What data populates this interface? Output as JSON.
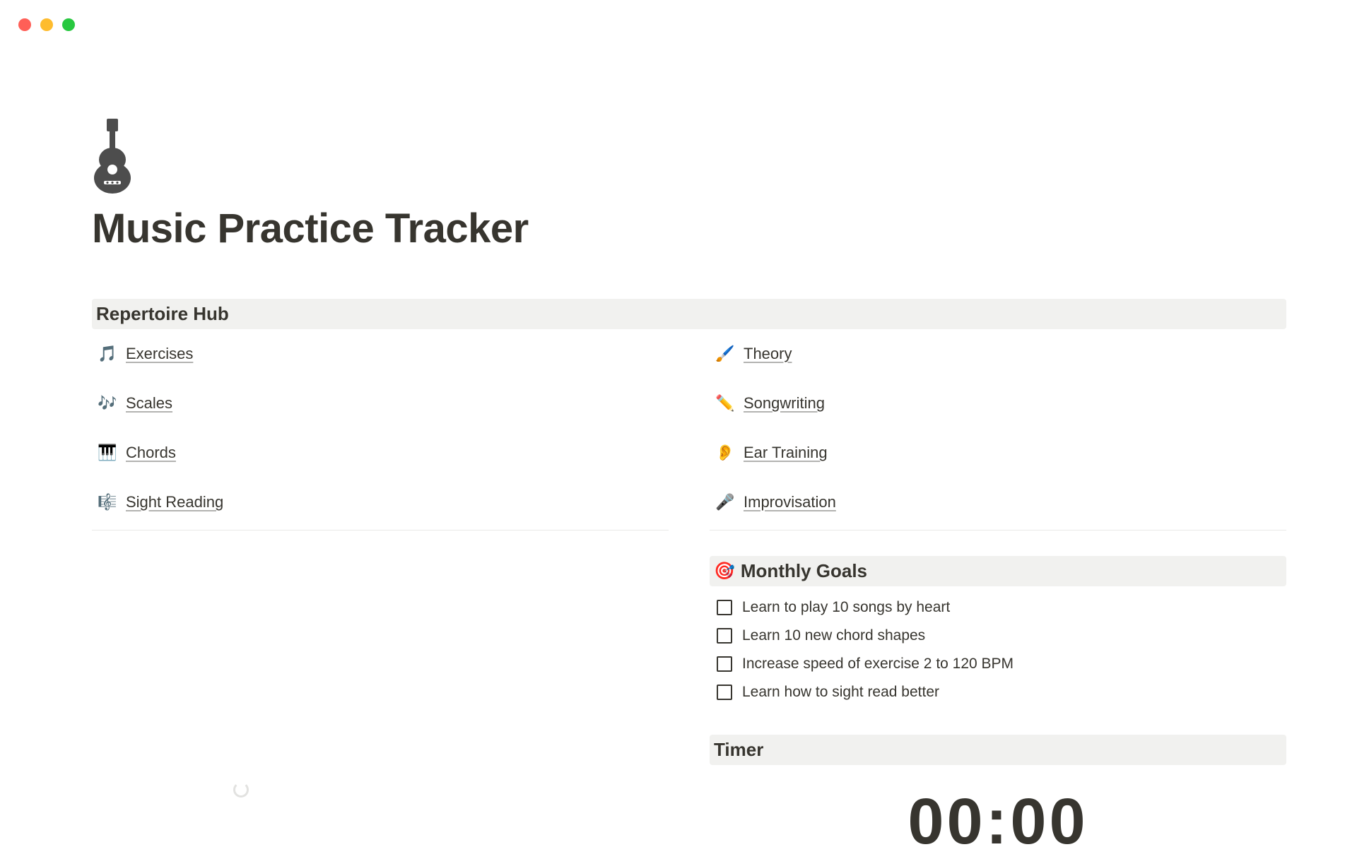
{
  "page": {
    "title": "Music Practice Tracker"
  },
  "sections": {
    "repertoire_header": "Repertoire Hub",
    "goals_header": "Monthly Goals",
    "timer_header": "Timer"
  },
  "repertoire": {
    "left": [
      {
        "icon": "🎵",
        "icon_name": "music-note-icon",
        "label": "Exercises"
      },
      {
        "icon": "🎶",
        "icon_name": "music-notes-icon",
        "label": "Scales"
      },
      {
        "icon": "🎹",
        "icon_name": "piano-icon",
        "label": "Chords"
      },
      {
        "icon": "🎼",
        "icon_name": "musical-score-icon",
        "label": "Sight Reading"
      }
    ],
    "right": [
      {
        "icon": "🖌️",
        "icon_name": "brush-icon",
        "label": "Theory"
      },
      {
        "icon": "✏️",
        "icon_name": "pencil-icon",
        "label": "Songwriting"
      },
      {
        "icon": "👂",
        "icon_name": "ear-icon",
        "label": "Ear Training"
      },
      {
        "icon": "🎤",
        "icon_name": "microphone-icon",
        "label": "Improvisation"
      }
    ]
  },
  "goals": [
    {
      "checked": false,
      "label": "Learn to play 10 songs by heart"
    },
    {
      "checked": false,
      "label": "Learn 10 new chord shapes"
    },
    {
      "checked": false,
      "label": "Increase speed of exercise 2 to 120 BPM"
    },
    {
      "checked": false,
      "label": "Learn how to sight read better"
    }
  ],
  "timer": {
    "display": "00:00"
  },
  "icon_colors": {
    "music-note-icon": "#d44c47",
    "music-notes-icon": "#ad1a72",
    "piano-icon": "#9065b0",
    "musical-score-icon": "#337ea9",
    "brush-icon": "#448361",
    "pencil-icon": "#d9730d",
    "ear-icon": "#cb912f",
    "microphone-icon": "#9f6b53"
  }
}
